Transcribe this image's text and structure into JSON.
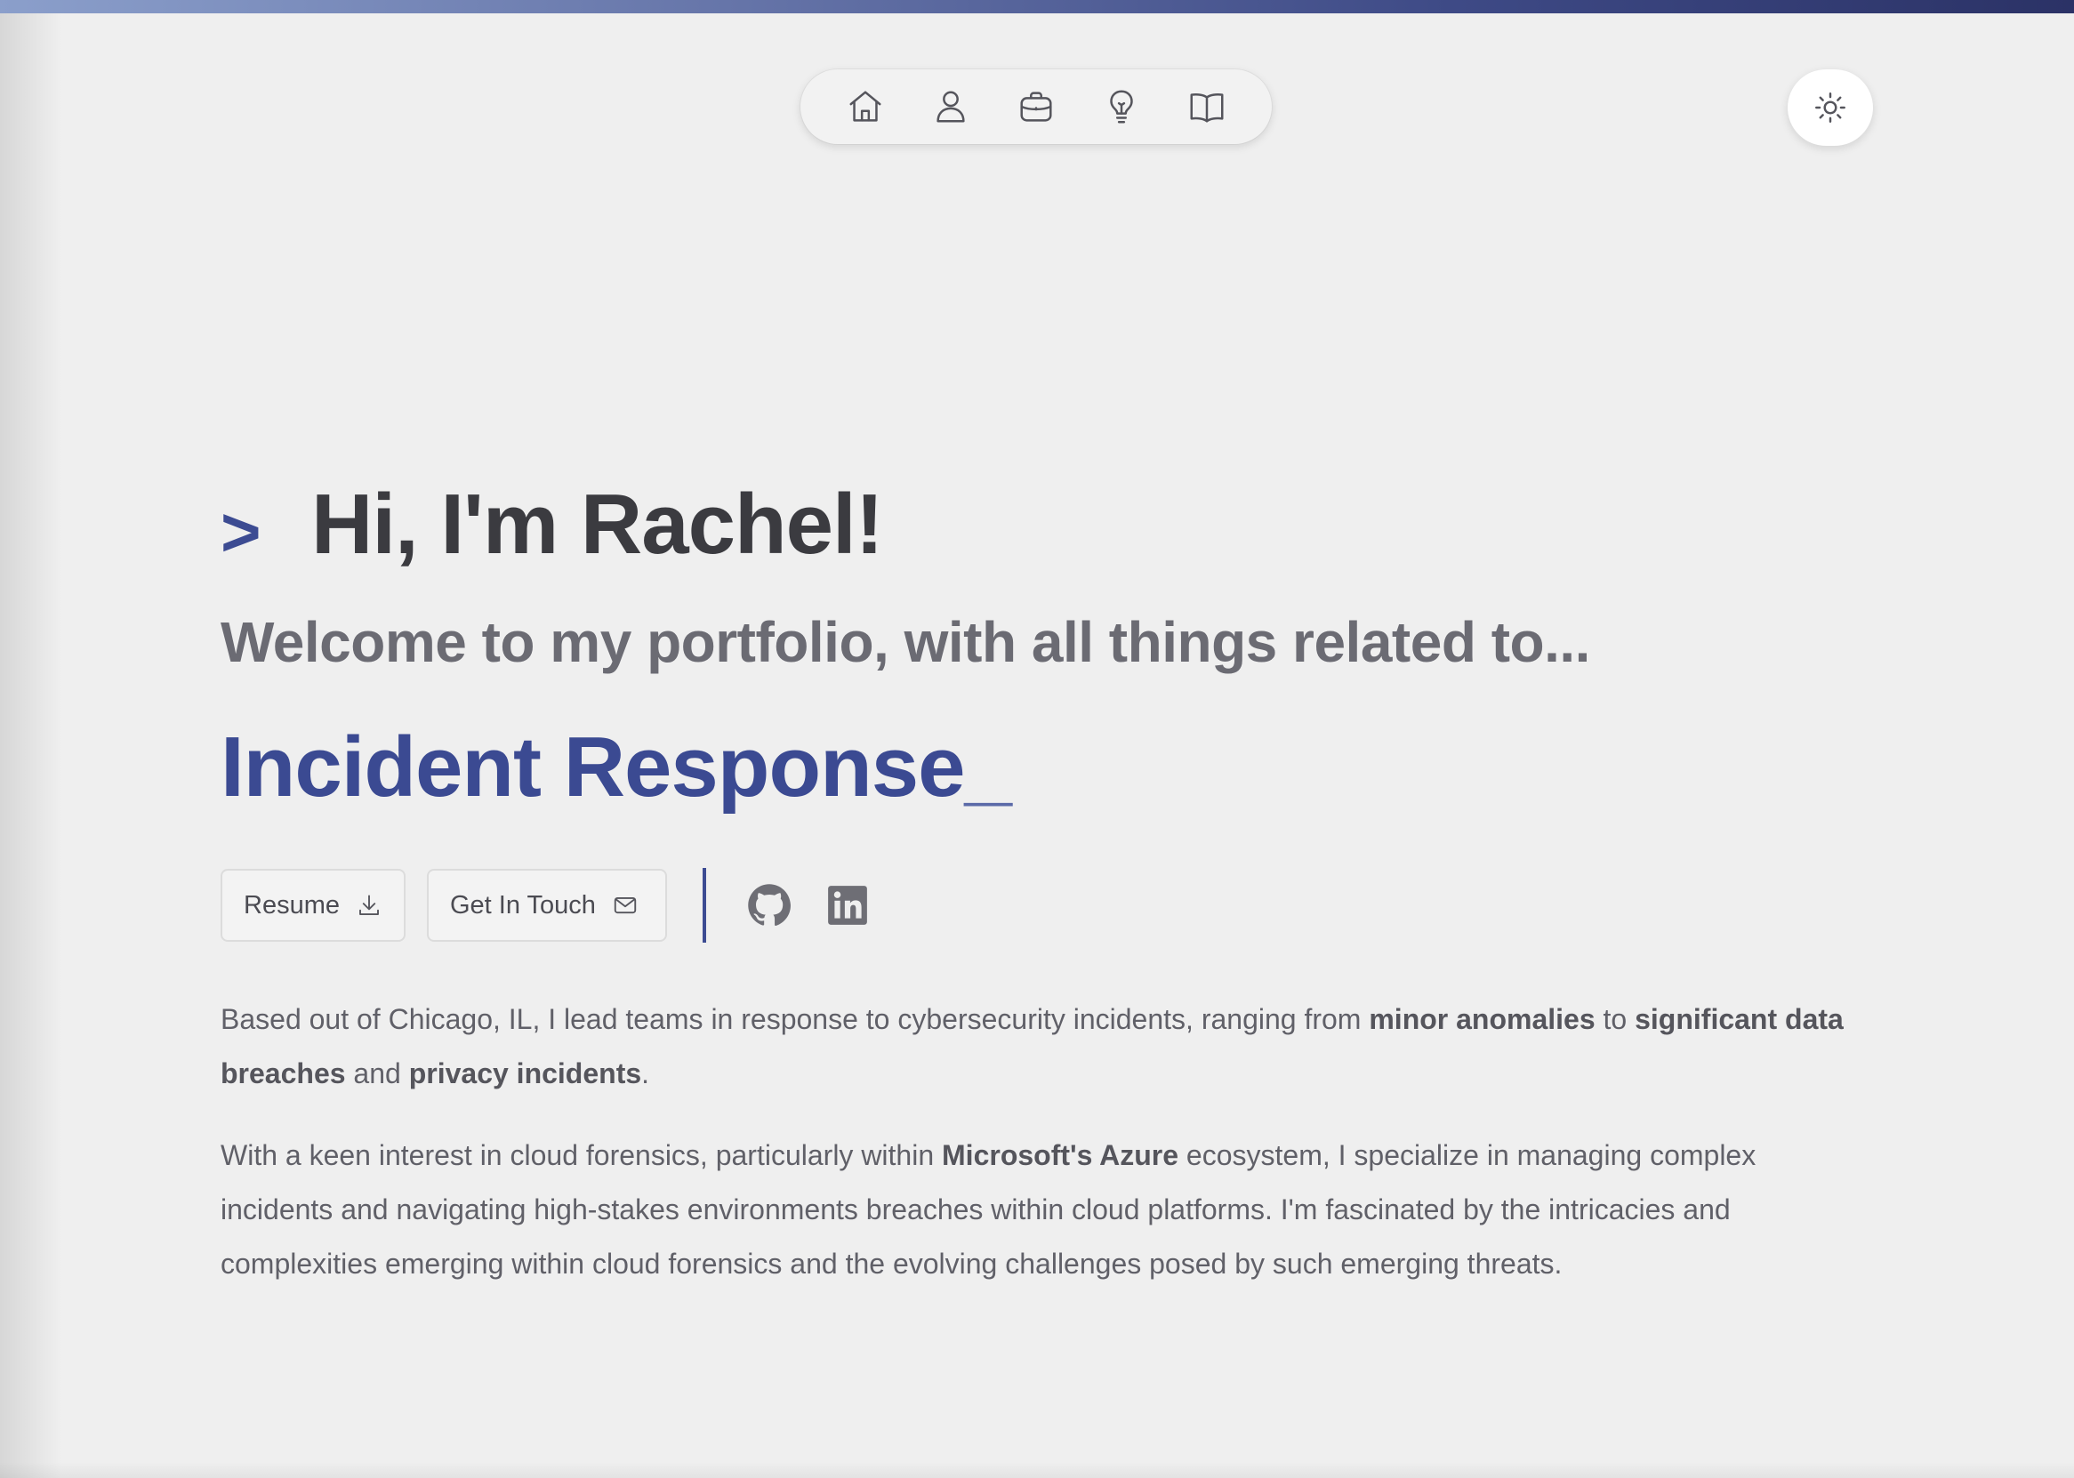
{
  "nav": {
    "items": [
      {
        "name": "home",
        "icon": "home-icon"
      },
      {
        "name": "about",
        "icon": "user-icon"
      },
      {
        "name": "experience",
        "icon": "briefcase-icon"
      },
      {
        "name": "projects",
        "icon": "lightbulb-icon"
      },
      {
        "name": "blog",
        "icon": "book-icon"
      }
    ],
    "theme_toggle_icon": "sun-icon"
  },
  "hero": {
    "prompt": ">",
    "greeting": "Hi, I'm Rachel!",
    "welcome": "Welcome to my portfolio, with all things related to...",
    "role": "Incident Response",
    "cursor": "_"
  },
  "actions": {
    "resume_label": "Resume",
    "contact_label": "Get In Touch",
    "social": [
      {
        "name": "github",
        "icon": "github-icon"
      },
      {
        "name": "linkedin",
        "icon": "linkedin-icon"
      }
    ]
  },
  "about": {
    "p1": {
      "t1": "Based out of Chicago, IL, I lead teams in response to cybersecurity incidents, ranging from ",
      "b1": "minor anomalies",
      "t2": " to ",
      "b2": "significant data breaches",
      "t3": " and ",
      "b3": "privacy incidents",
      "t4": "."
    },
    "p2": {
      "t1": "With a keen interest in cloud forensics, particularly within ",
      "b1": "Microsoft's Azure",
      "t2": " ecosystem, I specialize in managing complex incidents and navigating high-stakes environments breaches within cloud platforms. I'm fascinated by the intricacies and complexities emerging within cloud forensics and the evolving challenges posed by such emerging threats."
    }
  },
  "colors": {
    "accent": "#3c4b92",
    "heading": "#3b3b40",
    "muted": "#6b6b73",
    "background": "#efefef"
  }
}
